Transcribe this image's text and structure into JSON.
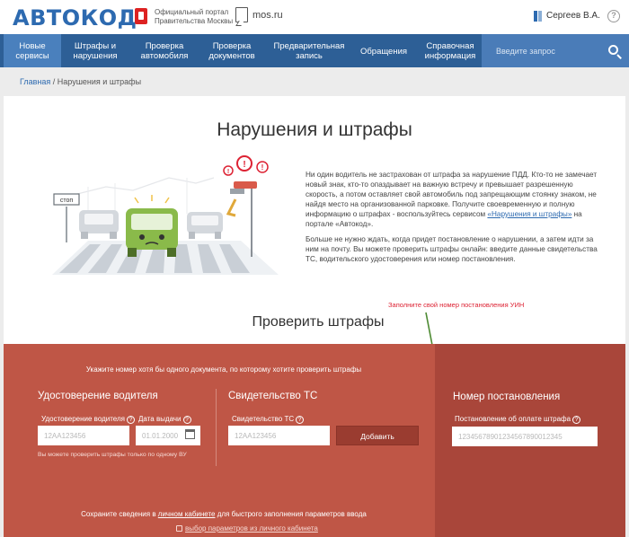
{
  "header": {
    "logo": "АВТОКОД",
    "portal_line1": "Официальный портал",
    "portal_line2": "Правительства Москвы",
    "mos": "mos.ru",
    "user": "Сергеев В.А.",
    "help": "?"
  },
  "nav": {
    "items": [
      {
        "label": "Новые сервисы"
      },
      {
        "label": "Штрафы и нарушения"
      },
      {
        "label": "Проверка автомобиля"
      },
      {
        "label": "Проверка документов"
      },
      {
        "label": "Предварительная запись"
      },
      {
        "label": "Обращения"
      },
      {
        "label": "Справочная информация"
      }
    ],
    "search_placeholder": "Введите запрос"
  },
  "breadcrumb": {
    "home": "Главная",
    "separator": " / ",
    "current": "Нарушения и штрафы"
  },
  "main": {
    "title": "Нарушения и штрафы",
    "sign_text": "стоп",
    "intro_p1_a": "Ни один водитель не застрахован от штрафа за нарушение ПДД. Кто-то не замечает новый знак, кто-то опаздывает на важную встречу и превышает разрешенную скорость, а потом оставляет свой автомобиль под запрещающим стоянку знаком, не найдя место на организованной парковке. Получите своевременную и полную информацию о штрафах - воспользуйтесь сервисом ",
    "intro_link": "«Нарушения и штрафы»",
    "intro_p1_b": " на портале «Автокод».",
    "intro_p2": "Больше не нужно ждать, когда придет постановление о нарушении, а затем идти за ним на почту. Вы можете проверить штрафы онлайн: введите данные свидетельства ТС, водительского удостоверения или номер постановления.",
    "check_title": "Проверить штрафы",
    "annotation": "Заполните свой номер постановления УИН"
  },
  "form": {
    "hint": "Укажите номер хотя бы одного документа, по которому хотите проверить штрафы",
    "license": {
      "title": "Удостоверение водителя",
      "field_label": "Удостоверение водителя",
      "field_placeholder": "12АА123456",
      "date_label": "Дата выдачи",
      "date_placeholder": "01.01.2000",
      "note": "Вы можете проверить штрафы только по одному ВУ"
    },
    "vehicle": {
      "title": "Свидетельство ТС",
      "field_label": "Свидетельство ТС",
      "field_placeholder": "12АА123456",
      "button": "Добавить"
    },
    "resolution": {
      "title": "Номер постановления",
      "field_label": "Постановление об оплате штрафа",
      "field_placeholder": "12345678901234567890012345"
    },
    "help": "?",
    "save_prefix": "Сохраните сведения в ",
    "save_link": "личном кабинете",
    "save_suffix": " для быстрого заполнения параметров ввода",
    "params_link": "выбор параметров из личного кабинета"
  },
  "colors": {
    "brand": "#2d6ab0",
    "nav": "#2d5f96",
    "form_bg": "#bf5646",
    "form_right_bg": "#a9463a",
    "annotation": "#dd2233"
  }
}
